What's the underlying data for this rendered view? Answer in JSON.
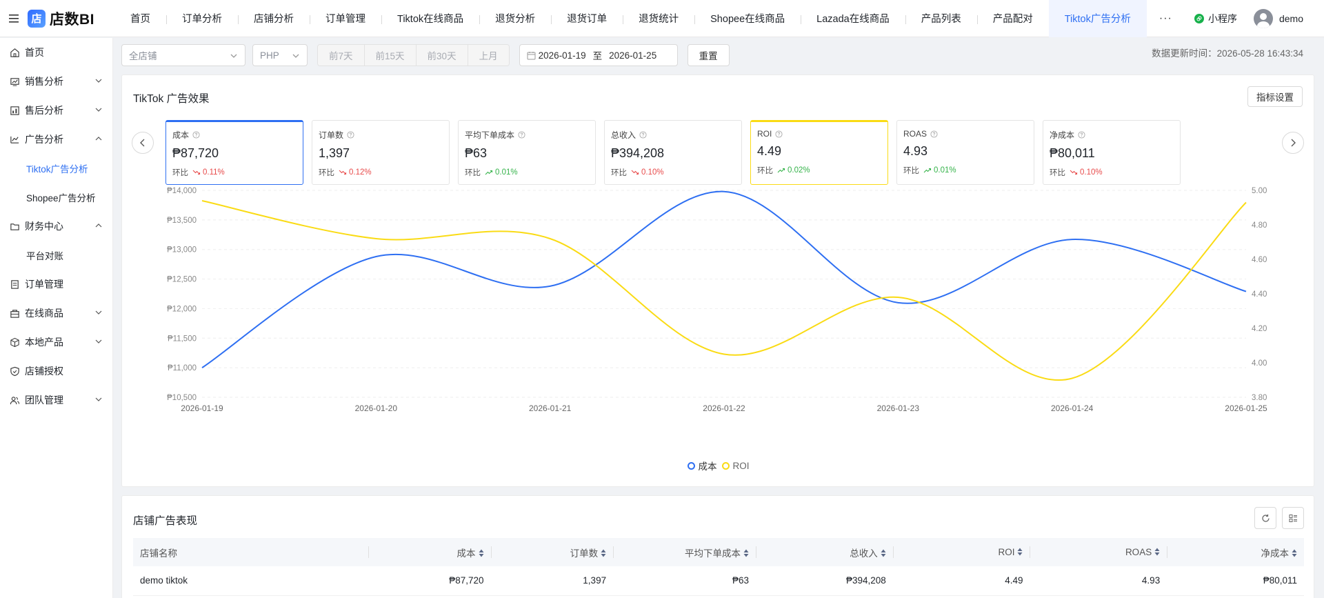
{
  "app": {
    "logo_mark": "店",
    "logo_text": "店数BI"
  },
  "nav": {
    "items": [
      "首页",
      "订单分析",
      "店铺分析",
      "订单管理",
      "Tiktok在线商品",
      "退货分析",
      "退货订单",
      "退货统计",
      "Shopee在线商品",
      "Lazada在线商品",
      "产品列表",
      "产品配对",
      "Tiktok广告分析"
    ],
    "active": "Tiktok广告分析",
    "more": "···"
  },
  "topright": {
    "mini_program": "小程序",
    "user": "demo"
  },
  "sidebar": {
    "items": [
      {
        "label": "首页",
        "icon": "home-icon"
      },
      {
        "label": "销售分析",
        "icon": "sales-icon",
        "chevron": "down"
      },
      {
        "label": "售后分析",
        "icon": "aftersales-icon",
        "chevron": "down"
      },
      {
        "label": "广告分析",
        "icon": "ads-icon",
        "chevron": "up"
      },
      {
        "label": "Tiktok广告分析",
        "sub": true,
        "active": true
      },
      {
        "label": "Shopee广告分析",
        "sub": true
      },
      {
        "label": "财务中心",
        "icon": "finance-icon",
        "chevron": "up"
      },
      {
        "label": "平台对账",
        "sub": true
      },
      {
        "label": "订单管理",
        "icon": "order-icon"
      },
      {
        "label": "在线商品",
        "icon": "product-icon",
        "chevron": "down"
      },
      {
        "label": "本地产品",
        "icon": "cube-icon",
        "chevron": "down"
      },
      {
        "label": "店铺授权",
        "icon": "shield-icon"
      },
      {
        "label": "团队管理",
        "icon": "team-icon",
        "chevron": "down"
      }
    ]
  },
  "filters": {
    "shop_placeholder": "全店铺",
    "currency": "PHP",
    "quick_ranges": [
      "前7天",
      "前15天",
      "前30天",
      "上月"
    ],
    "date_start": "2026-01-19",
    "date_sep": "至",
    "date_end": "2026-01-25",
    "reset": "重置"
  },
  "update_time": "数据更新时间：2026-05-28 16:43:34",
  "ad_card": {
    "title": "TikTok 广告效果",
    "metric_button": "指标设置",
    "kpis": [
      {
        "label": "成本",
        "value": "₱87,720",
        "trend_label": "环比",
        "change": "0.11%",
        "dir": "down",
        "selected": "blue"
      },
      {
        "label": "订单数",
        "value": "1,397",
        "trend_label": "环比",
        "change": "0.12%",
        "dir": "down",
        "selected": ""
      },
      {
        "label": "平均下单成本",
        "value": "₱63",
        "trend_label": "环比",
        "change": "0.01%",
        "dir": "up",
        "selected": ""
      },
      {
        "label": "总收入",
        "value": "₱394,208",
        "trend_label": "环比",
        "change": "0.10%",
        "dir": "down",
        "selected": ""
      },
      {
        "label": "ROI",
        "value": "4.49",
        "trend_label": "环比",
        "change": "0.02%",
        "dir": "up",
        "selected": "yellow"
      },
      {
        "label": "ROAS",
        "value": "4.93",
        "trend_label": "环比",
        "change": "0.01%",
        "dir": "up",
        "selected": ""
      },
      {
        "label": "净成本",
        "value": "₱80,011",
        "trend_label": "环比",
        "change": "0.10%",
        "dir": "down",
        "selected": ""
      }
    ]
  },
  "chart_data": {
    "type": "line",
    "x": [
      "2026-01-19",
      "2026-01-20",
      "2026-01-21",
      "2026-01-22",
      "2026-01-23",
      "2026-01-24",
      "2026-01-25"
    ],
    "y_left": {
      "ticks": [
        "₱10,500",
        "₱11,000",
        "₱11,500",
        "₱12,000",
        "₱12,500",
        "₱13,000",
        "₱13,500",
        "₱14,000"
      ],
      "min": 10500,
      "max": 14000
    },
    "y_right": {
      "ticks": [
        "3.80",
        "4.00",
        "4.20",
        "4.40",
        "4.60",
        "4.80",
        "5.00"
      ],
      "min": 3.8,
      "max": 5.0
    },
    "series": [
      {
        "name": "成本",
        "axis": "left",
        "color": "#2e6ff2",
        "values": [
          11000,
          12880,
          12380,
          13980,
          12100,
          13170,
          12290
        ]
      },
      {
        "name": "ROI",
        "axis": "right",
        "color": "#fadb14",
        "values": [
          4.94,
          4.72,
          4.72,
          4.05,
          4.38,
          3.91,
          4.93
        ]
      }
    ],
    "grid": true,
    "legend": "bottom-center"
  },
  "table_card": {
    "title": "店铺广告表现",
    "columns": [
      "店铺名称",
      "成本",
      "订单数",
      "平均下单成本",
      "总收入",
      "ROI",
      "ROAS",
      "净成本"
    ],
    "rows": [
      [
        "demo tiktok",
        "₱87,720",
        "1,397",
        "₱63",
        "₱394,208",
        "4.49",
        "4.93",
        "₱80,011"
      ]
    ]
  },
  "colors": {
    "accent": "#2e6ff2",
    "roi": "#fadb14",
    "down": "#e84a4a",
    "up": "#35b34a"
  }
}
